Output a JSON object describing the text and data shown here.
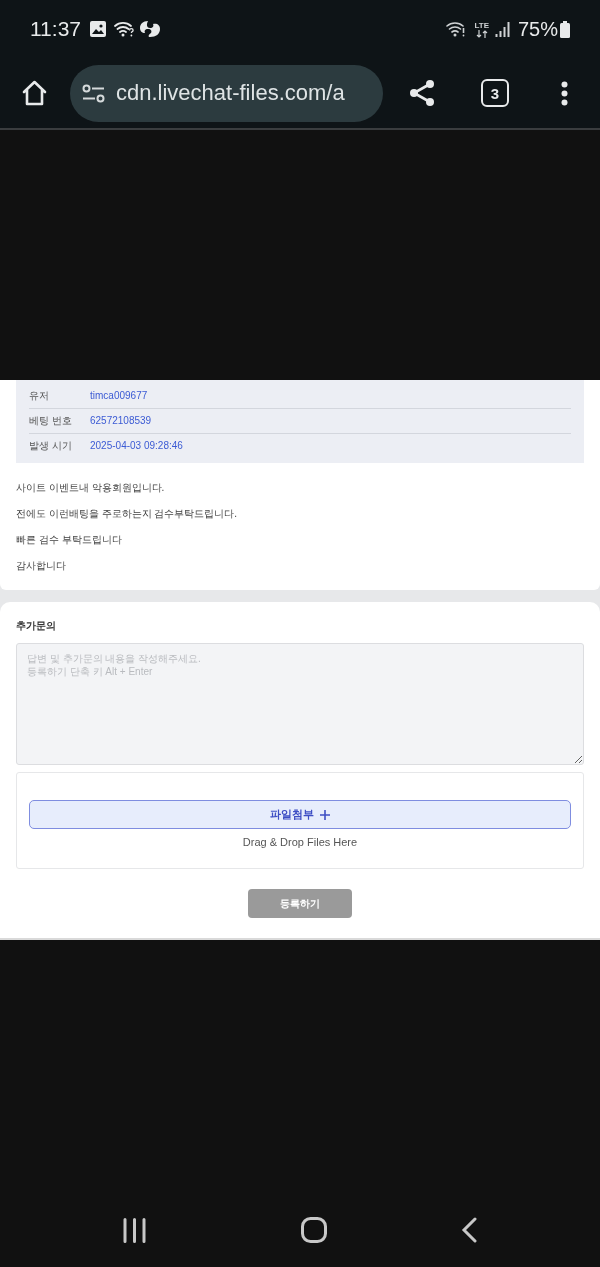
{
  "status_bar": {
    "time": "11:37",
    "network": "LTE",
    "battery": "75%"
  },
  "browser_toolbar": {
    "url": "cdn.livechat-files.com/a",
    "tab_count": "3"
  },
  "details": [
    {
      "label": "유저",
      "value": "timca009677"
    },
    {
      "label": "베팅 번호",
      "value": "62572108539"
    },
    {
      "label": "발생 시기",
      "value": "2025-04-03 09:28:46"
    }
  ],
  "message": [
    "사이트 이벤트내 악용회원입니다.",
    "전에도 이런배팅을 주로하는지 검수부탁드립니다.",
    "빠른 검수 부탁드립니다",
    "감사합니다"
  ],
  "inquiry": {
    "title": "추가문의",
    "placeholder": "답변 및 추가문의 내용을 작성해주세요.\n등록하기 단축 키 Alt + Enter",
    "attach_button": "파일첨부",
    "drop_hint": "Drag & Drop Files Here",
    "submit_button": "등록하기"
  }
}
